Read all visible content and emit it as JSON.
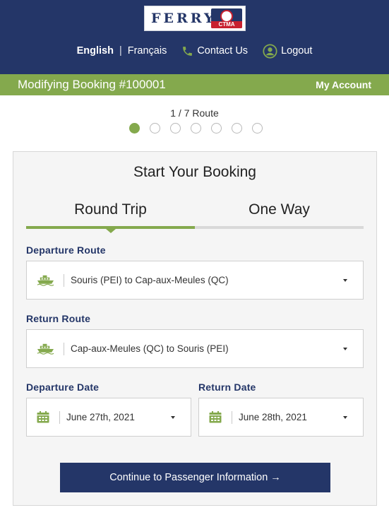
{
  "header": {
    "logo_text": "FERRY",
    "logo_badge": "CTMA",
    "lang_english": "English",
    "lang_sep": "|",
    "lang_french": "Français",
    "contact_label": "Contact Us",
    "logout_label": "Logout",
    "bg_color": "#243668"
  },
  "booking_bar": {
    "title": "Modifying Booking #100001",
    "account_label": "My Account",
    "bg_color": "#84a94d"
  },
  "progress": {
    "label": "1 / 7 Route",
    "current_step": 1,
    "total_steps": 7
  },
  "card": {
    "title": "Start Your Booking",
    "tabs": [
      {
        "label": "Round Trip",
        "active": true
      },
      {
        "label": "One Way",
        "active": false
      }
    ],
    "departure_route": {
      "label": "Departure Route",
      "value": "Souris (PEI) to Cap-aux-Meules (QC)",
      "icon": "ferry-icon"
    },
    "return_route": {
      "label": "Return Route",
      "value": "Cap-aux-Meules (QC) to Souris (PEI)",
      "icon": "ferry-icon"
    },
    "departure_date": {
      "label": "Departure Date",
      "value": "June 27th, 2021",
      "icon": "calendar-icon"
    },
    "return_date": {
      "label": "Return Date",
      "value": "June 28th, 2021",
      "icon": "calendar-icon"
    },
    "continue_button": "Continue to Passenger Information →"
  }
}
